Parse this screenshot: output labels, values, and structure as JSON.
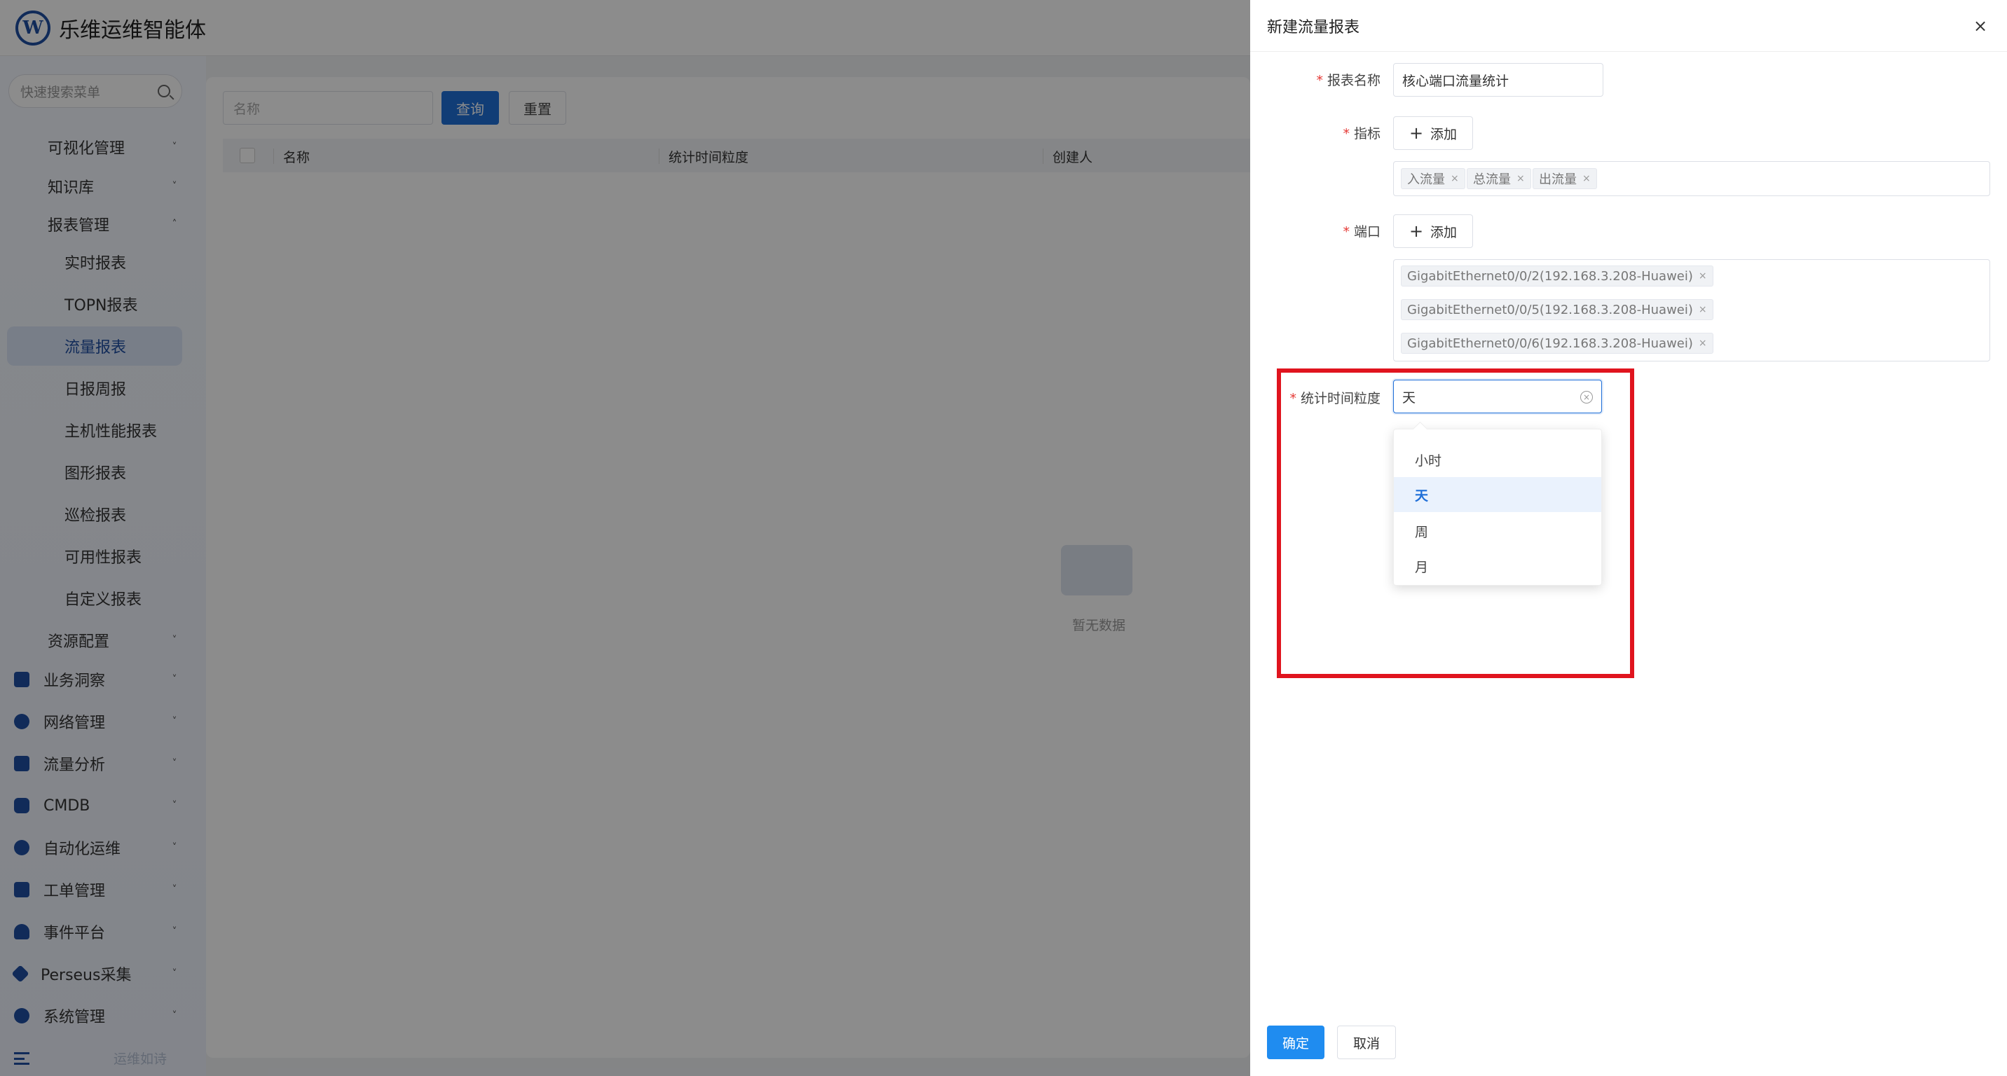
{
  "app": {
    "title": "乐维运维智能体",
    "logo_text": "W"
  },
  "sidebar": {
    "search_placeholder": "快速搜索菜单",
    "items": [
      {
        "label": "可视化管理",
        "chev": "˅"
      },
      {
        "label": "知识库",
        "chev": "˅"
      },
      {
        "label": "报表管理",
        "chev": "˄"
      },
      {
        "label": "实时报表"
      },
      {
        "label": "TOPN报表"
      },
      {
        "label": "流量报表"
      },
      {
        "label": "日报周报"
      },
      {
        "label": "主机性能报表"
      },
      {
        "label": "图形报表"
      },
      {
        "label": "巡检报表"
      },
      {
        "label": "可用性报表"
      },
      {
        "label": "自定义报表"
      },
      {
        "label": "资源配置",
        "chev": "˅"
      },
      {
        "label": "业务洞察",
        "chev": "˅"
      },
      {
        "label": "网络管理",
        "chev": "˅"
      },
      {
        "label": "流量分析",
        "chev": "˅"
      },
      {
        "label": "CMDB",
        "chev": "˅"
      },
      {
        "label": "自动化运维",
        "chev": "˅"
      },
      {
        "label": "工单管理",
        "chev": "˅"
      },
      {
        "label": "事件平台",
        "chev": "˅"
      },
      {
        "label": "Perseus采集",
        "chev": "˅"
      },
      {
        "label": "系统管理",
        "chev": "˅"
      }
    ],
    "bottom_text": "运维如诗"
  },
  "main": {
    "name_placeholder": "名称",
    "query_button": "查询",
    "reset_button": "重置",
    "columns": [
      "名称",
      "统计时间粒度",
      "创建人"
    ],
    "empty_text": "暂无数据"
  },
  "drawer": {
    "title": "新建流量报表",
    "close": "×",
    "name_label": "报表名称",
    "name_value": "核心端口流量统计",
    "metric_label": "指标",
    "add_label": "添加",
    "metrics": [
      "入流量",
      "总流量",
      "出流量"
    ],
    "port_label": "端口",
    "ports": [
      "GigabitEthernet0/0/2(192.168.3.208-Huawei)",
      "GigabitEthernet0/0/5(192.168.3.208-Huawei)",
      "GigabitEthernet0/0/6(192.168.3.208-Huawei)"
    ],
    "granularity_label": "统计时间粒度",
    "granularity_value": "天",
    "options": [
      "小时",
      "天",
      "周",
      "月"
    ],
    "selected_option": "天",
    "ok_button": "确定",
    "cancel_button": "取消"
  },
  "colors": {
    "primary": "#1f6fd8",
    "highlight": "#e0141e",
    "brand": "#1f4fa3"
  }
}
